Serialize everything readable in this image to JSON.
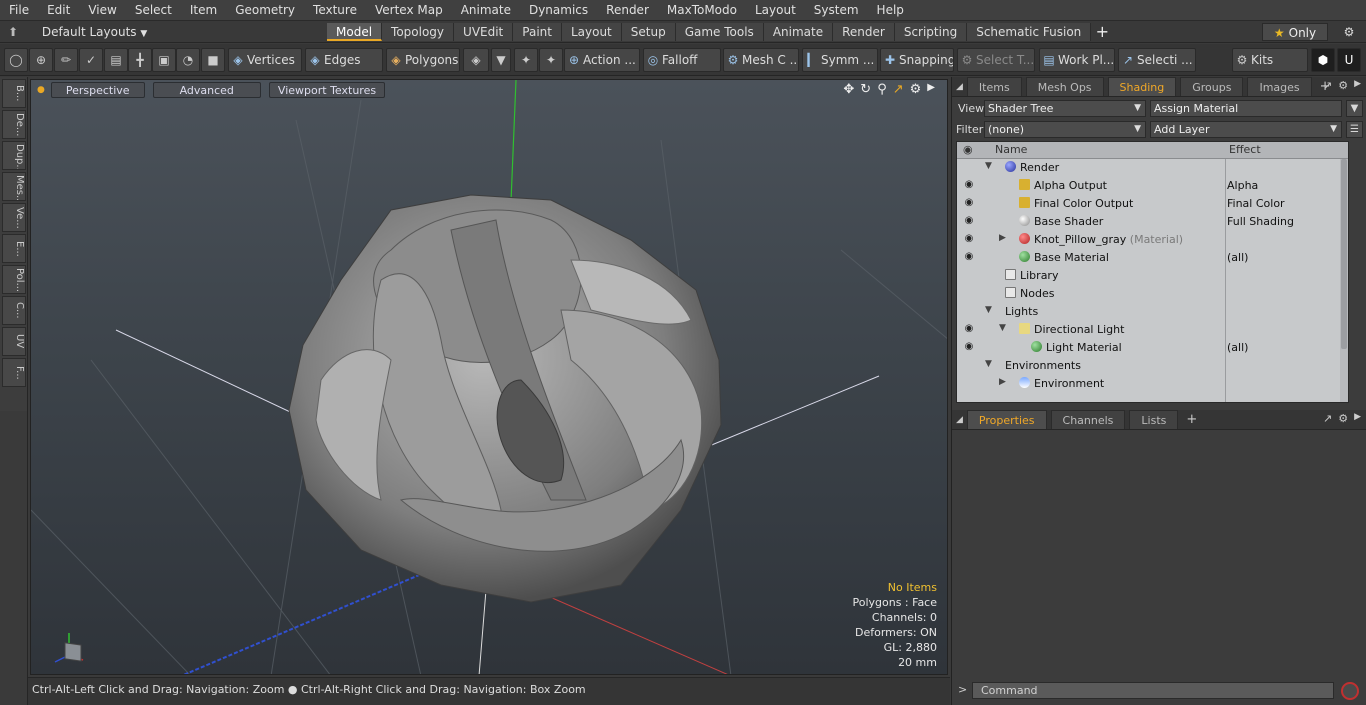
{
  "menu": [
    "File",
    "Edit",
    "View",
    "Select",
    "Item",
    "Geometry",
    "Texture",
    "Vertex Map",
    "Animate",
    "Dynamics",
    "Render",
    "MaxToModo",
    "Layout",
    "System",
    "Help"
  ],
  "layout_selector": "Default Layouts",
  "mode_tabs": [
    {
      "label": "Model",
      "active": true
    },
    {
      "label": "Topology",
      "active": false
    },
    {
      "label": "UVEdit",
      "active": false
    },
    {
      "label": "Paint",
      "active": false
    },
    {
      "label": "Layout",
      "active": false
    },
    {
      "label": "Setup",
      "active": false
    },
    {
      "label": "Game Tools",
      "active": false
    },
    {
      "label": "Animate",
      "active": false
    },
    {
      "label": "Render",
      "active": false
    },
    {
      "label": "Scripting",
      "active": false
    },
    {
      "label": "Schematic Fusion",
      "active": false
    }
  ],
  "only_label": "Only",
  "toolbar": {
    "vertices": "Vertices",
    "edges": "Edges",
    "polygons": "Polygons",
    "action": "Action",
    "falloff": "Falloff",
    "mesh_c": "Mesh C ...",
    "symm": "Symm ...",
    "snapping": "Snapping",
    "select_t": "Select T...",
    "work_pl": "Work Pl...",
    "selecti": "Selecti ...",
    "kits": "Kits"
  },
  "left_strip": [
    "B...",
    "De...",
    "Dup...",
    "Mes...",
    "Ve...",
    "E...",
    "Pol...",
    "C...",
    "UV",
    "F..."
  ],
  "viewport": {
    "buttons": [
      "Perspective",
      "Advanced",
      "Viewport Textures"
    ],
    "info": {
      "no_items": "No Items",
      "polygons": "Polygons : Face",
      "channels": "Channels: 0",
      "deformers": "Deformers: ON",
      "gl": "GL: 2,880",
      "size": "20 mm"
    }
  },
  "status_text": "Ctrl-Alt-Left Click and Drag: Navigation: Zoom ● Ctrl-Alt-Right Click and Drag: Navigation: Box Zoom",
  "right_panel": {
    "tabs": [
      {
        "label": "Items",
        "active": false
      },
      {
        "label": "Mesh Ops",
        "active": false
      },
      {
        "label": "Shading",
        "active": true
      },
      {
        "label": "Groups",
        "active": false
      },
      {
        "label": "Images",
        "active": false
      }
    ],
    "view_label": "View",
    "view_value": "Shader Tree",
    "assign_material": "Assign Material",
    "filter_label": "Filter",
    "filter_value": "(none)",
    "add_layer": "Add Layer",
    "tree_header": {
      "name": "Name",
      "effect": "Effect"
    },
    "tree_rows": [
      {
        "name": "Render",
        "effect": "",
        "suffix": ""
      },
      {
        "name": "Alpha Output",
        "effect": "Alpha",
        "suffix": ""
      },
      {
        "name": "Final Color Output",
        "effect": "Final Color",
        "suffix": ""
      },
      {
        "name": "Base Shader",
        "effect": "Full Shading",
        "suffix": ""
      },
      {
        "name": "Knot_Pillow_gray",
        "effect": "",
        "suffix": "(Material)"
      },
      {
        "name": "Base Material",
        "effect": "(all)",
        "suffix": ""
      },
      {
        "name": "Library",
        "effect": "",
        "suffix": ""
      },
      {
        "name": "Nodes",
        "effect": "",
        "suffix": ""
      },
      {
        "name": "Lights",
        "effect": "",
        "suffix": ""
      },
      {
        "name": "Directional Light",
        "effect": "",
        "suffix": ""
      },
      {
        "name": "Light Material",
        "effect": "(all)",
        "suffix": ""
      },
      {
        "name": "Environments",
        "effect": "",
        "suffix": ""
      },
      {
        "name": "Environment",
        "effect": "",
        "suffix": ""
      }
    ],
    "bottom_tabs": [
      {
        "label": "Properties",
        "active": true
      },
      {
        "label": "Channels",
        "active": false
      },
      {
        "label": "Lists",
        "active": false
      }
    ],
    "command_placeholder": "Command"
  }
}
